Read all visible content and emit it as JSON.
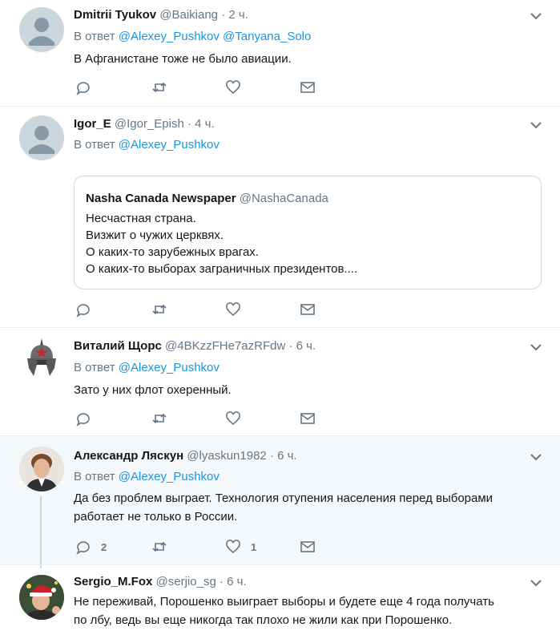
{
  "tweets": [
    {
      "name": "Dmitrii Tyukov",
      "handle": "@Baikiang",
      "sep": "·",
      "time": "2 ч.",
      "reply_prefix": "В ответ",
      "mentions": [
        "@Alexey_Pushkov",
        "@Tanyana_Solo"
      ],
      "text": "В Афганистане тоже не было авиации.",
      "reply_count": "",
      "like_count": ""
    },
    {
      "name": "Igor_E",
      "handle": "@Igor_Epish",
      "sep": "·",
      "time": "4 ч.",
      "reply_prefix": "В ответ",
      "mentions": [
        "@Alexey_Pushkov"
      ],
      "quote": {
        "name": "Nasha Canada Newspaper",
        "handle": "@NashaCanada",
        "lines": [
          "Несчастная страна.",
          "Визжит о чужих церквях.",
          "О каких-то зарубежных врагах.",
          "О каких-то выборах заграничных президентов...."
        ]
      },
      "reply_count": "",
      "like_count": ""
    },
    {
      "name": "Виталий Щорс",
      "handle": "@4BKzzFHe7azRFdw",
      "sep": "·",
      "time": "6 ч.",
      "reply_prefix": "В ответ",
      "mentions": [
        "@Alexey_Pushkov"
      ],
      "text": "Зато у них флот охеренный.",
      "reply_count": "",
      "like_count": ""
    },
    {
      "name": "Александр Ляскун",
      "handle": "@lyaskun1982",
      "sep": "·",
      "time": "6 ч.",
      "reply_prefix": "В ответ",
      "mentions": [
        "@Alexey_Pushkov"
      ],
      "text_lines": [
        "Да без проблем выграет. Технология отупения населения перед выборами",
        "работает не только в России."
      ],
      "reply_count": "2",
      "like_count": "1"
    },
    {
      "name": "Sergio_M.Fox",
      "handle": "@serjio_sg",
      "sep": "·",
      "time": "6 ч.",
      "text_lines": [
        "Не переживай, Порошенко выиграет выборы и будете еще 4 года получать",
        "по лбу, ведь вы еще никогда так плохо не жили как при Порошенко."
      ]
    }
  ],
  "icons": {
    "reply": "reply-icon",
    "retweet": "retweet-icon",
    "like": "heart-icon",
    "dm": "envelope-icon",
    "caret": "chevron-down-icon"
  },
  "colors": {
    "mention": "#1b95e0",
    "meta": "#657786",
    "highlight_bg": "#f5f8fa",
    "border": "#e6ecf0"
  }
}
